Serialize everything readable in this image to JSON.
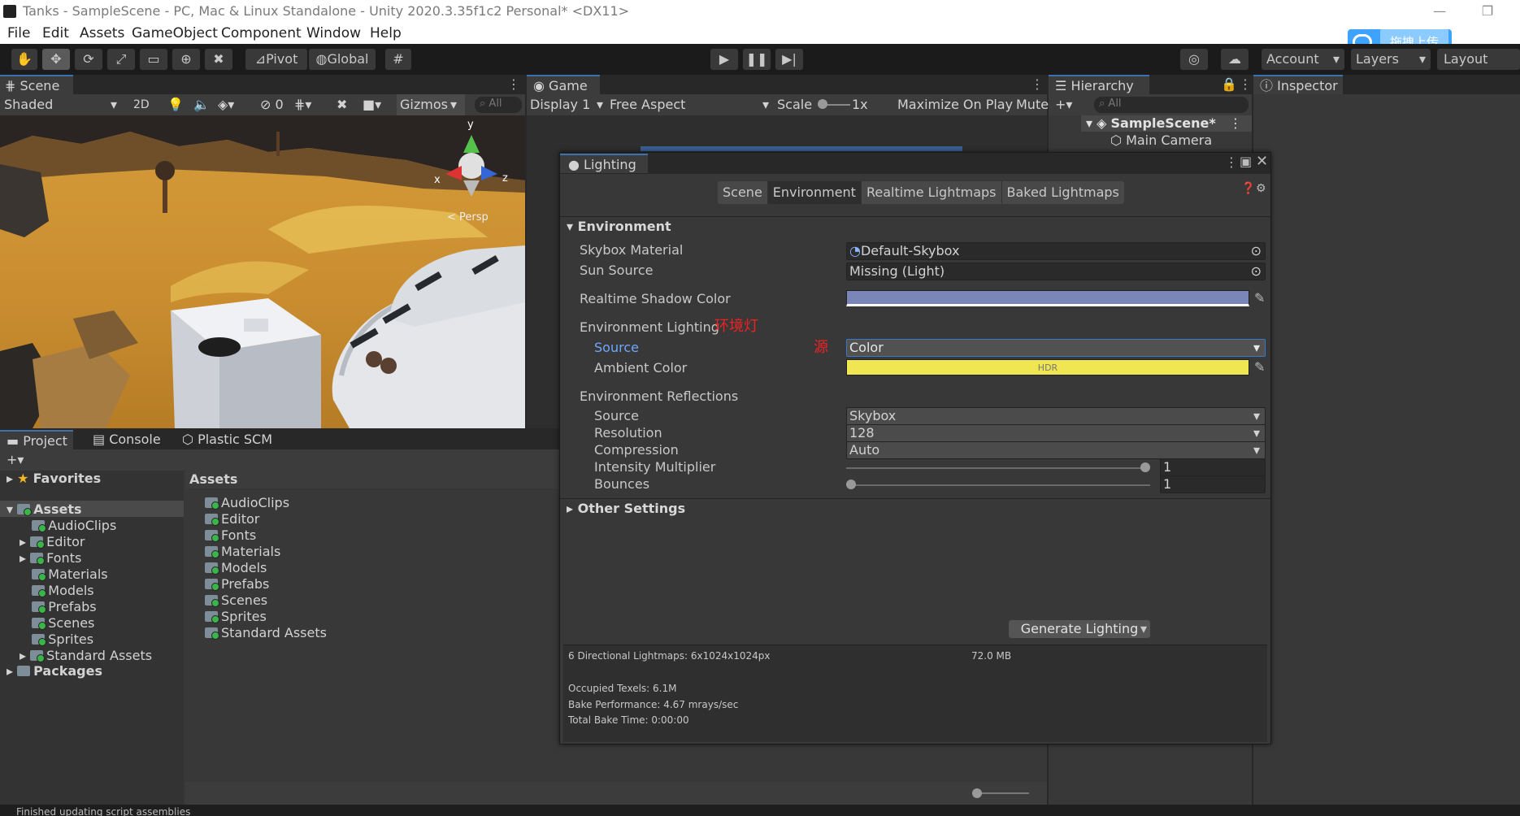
{
  "window": {
    "title": "Tanks - SampleScene - PC, Mac & Linux Standalone - Unity 2020.3.35f1c2 Personal* <DX11>",
    "minimize": "—",
    "restore": "❐"
  },
  "menu": [
    "File",
    "Edit",
    "Assets",
    "GameObject",
    "Component",
    "Window",
    "Help"
  ],
  "upload_badge": "拖拽上传",
  "toolbar": {
    "pivot": "Pivot",
    "global": "Global",
    "account": "Account",
    "layers": "Layers",
    "layout": "Layout"
  },
  "scene_panel": {
    "tab": "Scene",
    "shading": "Shaded",
    "mode_2d": "2D",
    "hidden_count": "0",
    "gizmos": "Gizmos",
    "search_placeholder": "All",
    "persp_label": "< Persp",
    "axis_y": "y",
    "axis_x": "x",
    "axis_z": "z"
  },
  "game_panel": {
    "tab": "Game",
    "display": "Display 1",
    "aspect": "Free Aspect",
    "scale_label": "Scale",
    "scale_value": "1x",
    "maximize": "Maximize On Play",
    "mute": "Mute"
  },
  "hierarchy": {
    "tab": "Hierarchy",
    "search_placeholder": "All",
    "scene": "SampleScene*",
    "items": [
      "Main Camera"
    ]
  },
  "inspector": {
    "tab": "Inspector"
  },
  "lighting": {
    "title": "Lighting",
    "tabs": [
      "Scene",
      "Environment",
      "Realtime Lightmaps",
      "Baked Lightmaps"
    ],
    "selected_tab": "Environment",
    "section_environment": "Environment",
    "skybox_material_label": "Skybox Material",
    "skybox_material_value": "Default-Skybox",
    "sun_source_label": "Sun Source",
    "sun_source_value": "Missing (Light)",
    "realtime_shadow_label": "Realtime Shadow Color",
    "realtime_shadow_color": "#7b86b8",
    "env_lighting_label": "Environment Lighting",
    "annotation_env": "环境灯",
    "source_label": "Source",
    "annotation_source": "源",
    "source_value": "Color",
    "ambient_label": "Ambient Color",
    "ambient_color": "#f0e652",
    "ambient_hdr": "HDR",
    "env_reflections_label": "Environment Reflections",
    "refl_source_label": "Source",
    "refl_source_value": "Skybox",
    "resolution_label": "Resolution",
    "resolution_value": "128",
    "compression_label": "Compression",
    "compression_value": "Auto",
    "intensity_label": "Intensity Multiplier",
    "intensity_value": "1",
    "intensity_fraction": 1.0,
    "bounces_label": "Bounces",
    "bounces_value": "1",
    "bounces_fraction": 0.0,
    "section_other": "Other Settings",
    "generate_button": "Generate Lighting",
    "stats": {
      "lightmaps": "6 Directional Lightmaps: 6x1024x1024px",
      "size": "72.0 MB",
      "texels": "Occupied Texels: 6.1M",
      "performance": "Bake Performance: 4.67 mrays/sec",
      "time": "Total Bake Time: 0:00:00"
    }
  },
  "project": {
    "tabs": [
      "Project",
      "Console",
      "Plastic SCM"
    ],
    "favorites": "Favorites",
    "assets_root": "Assets",
    "tree": [
      "AudioClips",
      "Editor",
      "Fonts",
      "Materials",
      "Models",
      "Prefabs",
      "Scenes",
      "Sprites",
      "Standard Assets"
    ],
    "packages": "Packages",
    "breadcrumb": "Assets",
    "grid": [
      "AudioClips",
      "Editor",
      "Fonts",
      "Materials",
      "Models",
      "Prefabs",
      "Scenes",
      "Sprites",
      "Standard Assets"
    ]
  },
  "statusbar": {
    "text": "Finished updating script assemblies"
  }
}
